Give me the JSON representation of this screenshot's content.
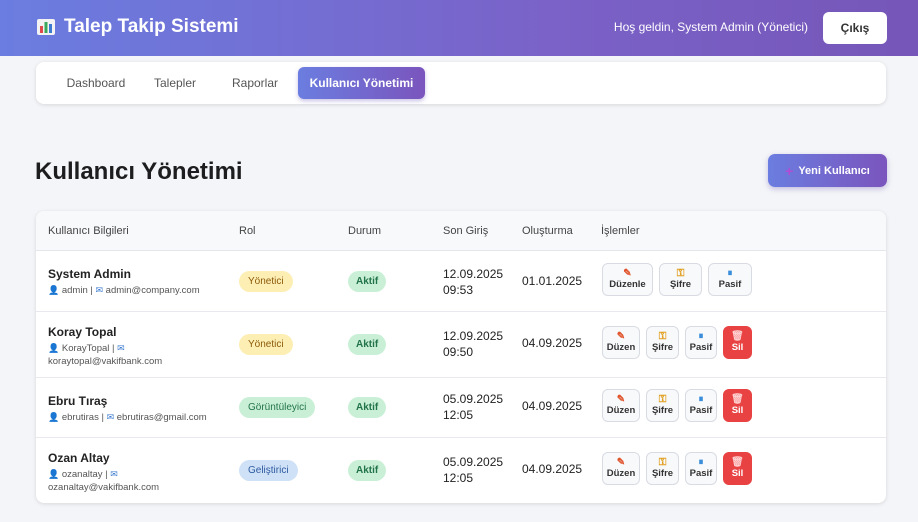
{
  "header": {
    "app_title": "Talep Takip Sistemi",
    "welcome": "Hoş geldin, System Admin (Yönetici)",
    "logout_label": "Çıkış"
  },
  "nav": {
    "tabs": [
      {
        "label": "Dashboard"
      },
      {
        "label": "Talepler"
      },
      {
        "label": "Raporlar"
      },
      {
        "label": "Kullanıcı Yönetimi",
        "active": true
      }
    ]
  },
  "page": {
    "title": "Kullanıcı Yönetimi",
    "new_user_label": "Yeni Kullanıcı"
  },
  "table": {
    "columns": [
      "Kullanıcı Bilgileri",
      "Rol",
      "Durum",
      "Son Giriş",
      "Oluşturma",
      "İşlemler"
    ],
    "rows": [
      {
        "name": "System Admin",
        "meta_line1": "admin | ",
        "meta_email": "admin@company.com",
        "meta_line2": "",
        "role": "Yönetici",
        "status": "Aktif",
        "last_login_date": "12.09.2025",
        "last_login_time": "09:53",
        "created": "01.01.2025",
        "edit": "Düzenle",
        "password": "Şifre",
        "deactivate": "Pasif",
        "delete": ""
      },
      {
        "name": "Koray Topal",
        "meta_line1": "KorayTopal | ",
        "meta_email": "",
        "meta_line2": "koraytopal@vakifbank.com",
        "role": "Yönetici",
        "status": "Aktif",
        "last_login_date": "12.09.2025",
        "last_login_time": "09:50",
        "created": "04.09.2025",
        "edit": "Düzen",
        "password": "Şifre",
        "deactivate": "Pasif",
        "delete": "Sil"
      },
      {
        "name": "Ebru Tıraş",
        "meta_line1": "ebrutiras | ",
        "meta_email": "ebrutiras@gmail.com",
        "meta_line2": "",
        "role": "Görüntüleyici",
        "status": "Aktif",
        "last_login_date": "05.09.2025",
        "last_login_time": "12:05",
        "created": "04.09.2025",
        "edit": "Düzen",
        "password": "Şifre",
        "deactivate": "Pasif",
        "delete": "Sil"
      },
      {
        "name": "Ozan Altay",
        "meta_line1": "ozanaltay | ",
        "meta_email": "",
        "meta_line2": "ozanaltay@vakifbank.com",
        "role": "Geliştirici",
        "status": "Aktif",
        "last_login_date": "05.09.2025",
        "last_login_time": "12:05",
        "created": "04.09.2025",
        "edit": "Düzen",
        "password": "Şifre",
        "deactivate": "Pasif",
        "delete": "Sil"
      }
    ]
  },
  "colors": {
    "header_gradient_start": "#6b7de0",
    "header_gradient_end": "#7656b8",
    "delete_red": "#e84242",
    "badge_admin": "#fdeeb4",
    "badge_viewer": "#c9f0d6",
    "badge_developer": "#cfe1f7"
  },
  "icons": {
    "brand": "bar-chart-icon",
    "new_user": "plus-icon",
    "person": "person-icon",
    "mail": "mail-icon",
    "edit": "pencil-icon",
    "password": "key-icon",
    "deactivate": "pause-icon",
    "delete": "trash-icon"
  }
}
